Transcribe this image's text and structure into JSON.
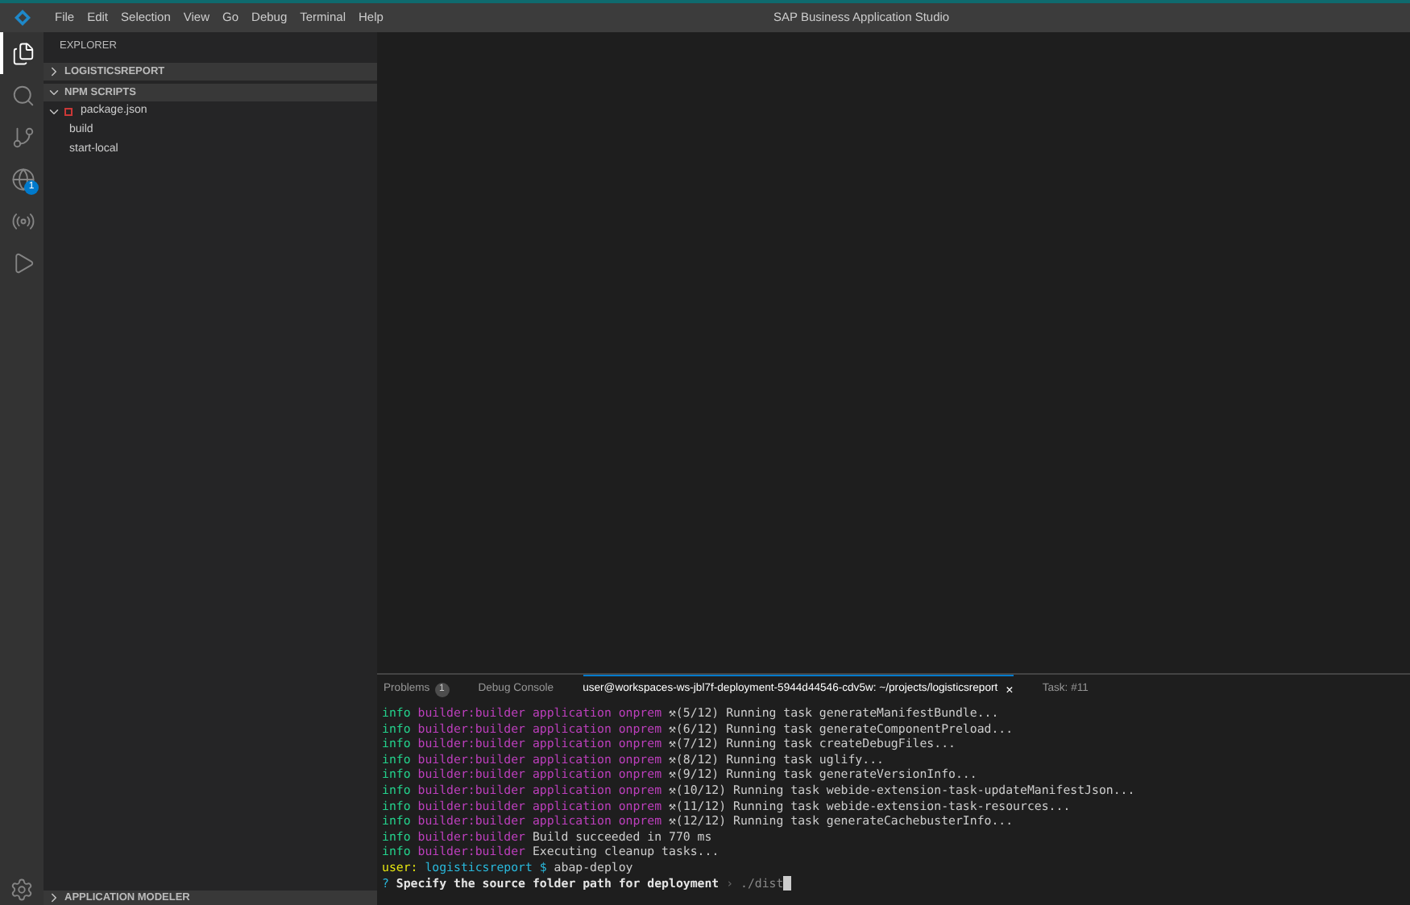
{
  "window": {
    "title": "SAP Business Application Studio",
    "menu": [
      "File",
      "Edit",
      "Selection",
      "View",
      "Go",
      "Debug",
      "Terminal",
      "Help"
    ]
  },
  "activity_bar": [
    {
      "kind": "files",
      "selected": true
    },
    {
      "kind": "search",
      "selected": false
    },
    {
      "kind": "branch",
      "selected": false
    },
    {
      "kind": "globe",
      "selected": false,
      "badge": "1"
    },
    {
      "kind": "probe",
      "selected": false
    },
    {
      "kind": "run",
      "selected": false
    }
  ],
  "sidebar": {
    "title": "EXPLORER",
    "sections": [
      {
        "label": "LOGISTICSREPORT",
        "expanded": false
      },
      {
        "label": "NPM SCRIPTS",
        "expanded": true,
        "children": [
          {
            "label": "package.json",
            "expanded": true,
            "children": [
              {
                "label": "build"
              },
              {
                "label": "start-local"
              }
            ]
          }
        ]
      }
    ],
    "bottom_section": {
      "label": "APPLICATION MODELER",
      "expanded": false
    }
  },
  "panel": {
    "tabs": [
      {
        "label": "Problems",
        "badge": "1",
        "selected": false,
        "closable": false
      },
      {
        "label": "Debug Console",
        "selected": false,
        "closable": false
      },
      {
        "label": "user@workspaces-ws-jbl7f-deployment-5944d44546-cdv5w: ~/projects/logisticsreport",
        "selected": true,
        "closable": true,
        "close": "×"
      },
      {
        "label": "Task: #11",
        "selected": false,
        "closable": false
      }
    ],
    "terminal_lines": [
      [
        {
          "text": "info ",
          "color": "#23d18b"
        },
        {
          "text": "builder:builder application onprem ",
          "color": "#bc3fbc"
        },
        {
          "text": "⚒(5/12) Running task generateManifestBundle...",
          "color": "#cccccc"
        }
      ],
      [
        {
          "text": "info ",
          "color": "#23d18b"
        },
        {
          "text": "builder:builder application onprem ",
          "color": "#bc3fbc"
        },
        {
          "text": "⚒(6/12) Running task generateComponentPreload...",
          "color": "#cccccc"
        }
      ],
      [
        {
          "text": "info ",
          "color": "#23d18b"
        },
        {
          "text": "builder:builder application onprem ",
          "color": "#bc3fbc"
        },
        {
          "text": "⚒(7/12) Running task createDebugFiles...",
          "color": "#cccccc"
        }
      ],
      [
        {
          "text": "info ",
          "color": "#23d18b"
        },
        {
          "text": "builder:builder application onprem ",
          "color": "#bc3fbc"
        },
        {
          "text": "⚒(8/12) Running task uglify...",
          "color": "#cccccc"
        }
      ],
      [
        {
          "text": "info ",
          "color": "#23d18b"
        },
        {
          "text": "builder:builder application onprem ",
          "color": "#bc3fbc"
        },
        {
          "text": "⚒(9/12) Running task generateVersionInfo...",
          "color": "#cccccc"
        }
      ],
      [
        {
          "text": "info ",
          "color": "#23d18b"
        },
        {
          "text": "builder:builder application onprem ",
          "color": "#bc3fbc"
        },
        {
          "text": "⚒(10/12) Running task webide-extension-task-updateManifestJson...",
          "color": "#cccccc"
        }
      ],
      [
        {
          "text": "info ",
          "color": "#23d18b"
        },
        {
          "text": "builder:builder application onprem ",
          "color": "#bc3fbc"
        },
        {
          "text": "⚒(11/12) Running task webide-extension-task-resources...",
          "color": "#cccccc"
        }
      ],
      [
        {
          "text": "info ",
          "color": "#23d18b"
        },
        {
          "text": "builder:builder application onprem ",
          "color": "#bc3fbc"
        },
        {
          "text": "⚒(12/12) Running task generateCachebusterInfo...",
          "color": "#cccccc"
        }
      ],
      [
        {
          "text": "info ",
          "color": "#23d18b"
        },
        {
          "text": "builder:builder ",
          "color": "#bc3fbc"
        },
        {
          "text": "Build succeeded in 770 ms",
          "color": "#cccccc"
        }
      ],
      [
        {
          "text": "info ",
          "color": "#23d18b"
        },
        {
          "text": "builder:builder ",
          "color": "#bc3fbc"
        },
        {
          "text": "Executing cleanup tasks...",
          "color": "#cccccc"
        }
      ],
      [
        {
          "text": "user: ",
          "color": "#e5e510"
        },
        {
          "text": "logisticsreport $ ",
          "color": "#29b8db"
        },
        {
          "text": "abap-deploy",
          "color": "#cccccc"
        }
      ],
      [
        {
          "text": "? ",
          "color": "#29b8db"
        },
        {
          "text": "Specify the source folder path for deployment ",
          "color": "#e5e5e5",
          "bold": true
        },
        {
          "text": "› ",
          "color": "#666666"
        },
        {
          "text": "./dist",
          "color": "#888888"
        }
      ]
    ],
    "cursor": true
  }
}
